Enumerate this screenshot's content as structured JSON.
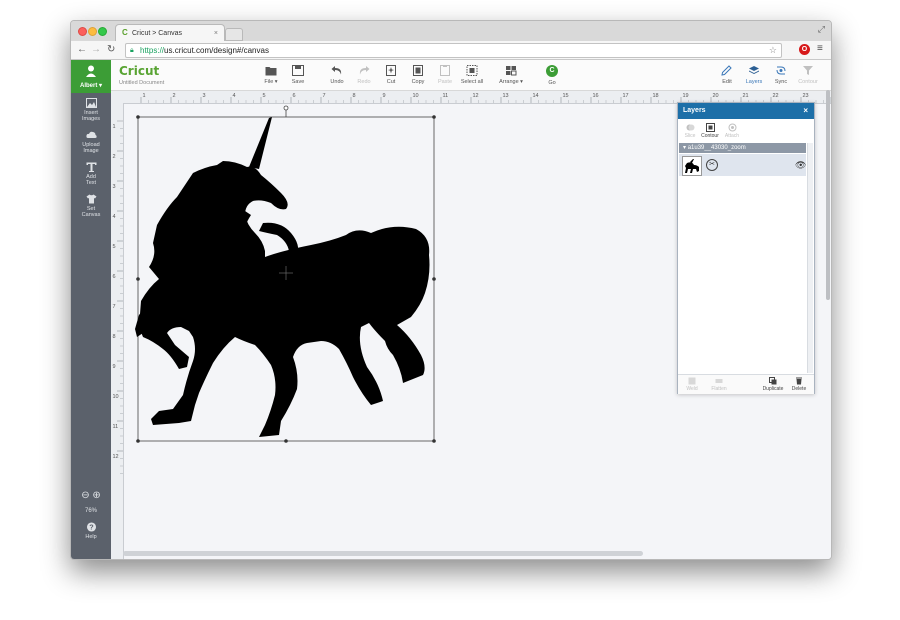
{
  "browser": {
    "tab_title": "Cricut > Canvas",
    "tab_close": "×",
    "url_scheme": "https://",
    "url_rest": "us.cricut.com/design#/canvas"
  },
  "sidebar": {
    "user_name": "Albert ▾",
    "items": [
      {
        "label_1": "Insert",
        "label_2": "Images"
      },
      {
        "label_1": "Upload",
        "label_2": "Image"
      },
      {
        "label_1": "Add",
        "label_2": "Text"
      },
      {
        "label_1": "Set",
        "label_2": "Canvas"
      }
    ],
    "zoom_percent": "76%",
    "help_label": "Help"
  },
  "toolbar": {
    "logo": "Cricut",
    "document_name": "Untitled Document",
    "buttons": {
      "file": "File ▾",
      "save": "Save",
      "undo": "Undo",
      "redo": "Redo",
      "cut": "Cut",
      "copy": "Copy",
      "paste": "Paste",
      "select_all": "Select all",
      "arrange": "Arrange ▾",
      "go": "Go",
      "edit": "Edit",
      "layers": "Layers",
      "sync": "Sync",
      "contour_right": "Contour"
    }
  },
  "ruler": {
    "top_ticks": [
      "1",
      "2",
      "3",
      "4",
      "5",
      "6",
      "7",
      "8",
      "9",
      "10",
      "11",
      "12",
      "13",
      "14",
      "15",
      "16",
      "17",
      "18",
      "19",
      "20",
      "21",
      "22",
      "23",
      "24"
    ],
    "left_ticks": [
      "1",
      "2",
      "3",
      "4",
      "5",
      "6",
      "7",
      "8",
      "9",
      "10",
      "11",
      "12"
    ]
  },
  "layers_panel": {
    "title": "Layers",
    "close": "×",
    "top_tools": [
      "Slice",
      "Contour",
      "Attach"
    ],
    "group_name": "a1u39__43030_zoom",
    "footer_tools": [
      "Weld",
      "Flatten",
      "Duplicate",
      "Delete"
    ]
  },
  "colors": {
    "brand_green": "#3c9d36",
    "sidebar_gray": "#5b616b",
    "panel_blue": "#1d6fa8"
  }
}
